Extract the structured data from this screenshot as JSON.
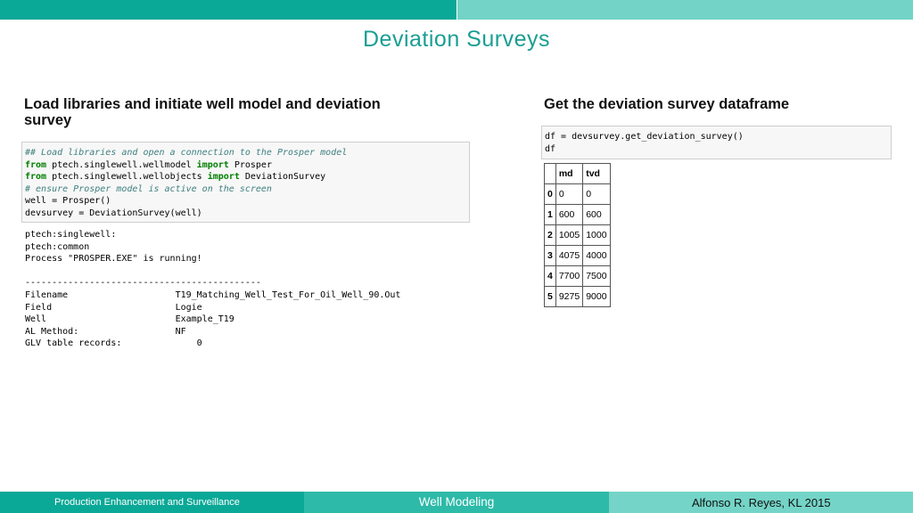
{
  "slide": {
    "title": "Deviation Surveys"
  },
  "left_section": {
    "heading_line1": "Load libraries and initiate well model and deviation",
    "heading_line2": "survey",
    "code": {
      "line1": "## Load libraries and open a connection to the Prosper model",
      "line2_kw1": "from",
      "line2_mid": " ptech.singlewell.wellmodel ",
      "line2_kw2": "import",
      "line2_end": " Prosper",
      "line3_kw1": "from",
      "line3_mid": " ptech.singlewell.wellobjects ",
      "line3_kw2": "import",
      "line3_end": " DeviationSurvey",
      "line4": "# ensure Prosper model is active on the screen",
      "line5": "well = Prosper()",
      "line6": "devsurvey = DeviationSurvey(well)"
    },
    "output": [
      "ptech:singlewell:",
      "ptech:common",
      "Process \"PROSPER.EXE\" is running!",
      "",
      "--------------------------------------------",
      "Filename                    T19_Matching_Well_Test_For_Oil_Well_90.Out",
      "Field                       Logie",
      "Well                        Example_T19",
      "AL Method:                  NF",
      "GLV table records:              0"
    ]
  },
  "right_section": {
    "heading": "Get the deviation survey dataframe",
    "code": {
      "line1": "df = devsurvey.get_deviation_survey()",
      "line2": "df"
    },
    "table": {
      "columns": [
        "",
        "md",
        "tvd"
      ],
      "rows": [
        [
          "0",
          "0",
          "0"
        ],
        [
          "1",
          "600",
          "600"
        ],
        [
          "2",
          "1005",
          "1000"
        ],
        [
          "3",
          "4075",
          "4000"
        ],
        [
          "4",
          "7700",
          "7500"
        ],
        [
          "5",
          "9275",
          "9000"
        ]
      ]
    }
  },
  "footer": {
    "left": "Production Enhancement and Surveillance",
    "center": "Well Modeling",
    "right": "Alfonso R. Reyes, KL 2015"
  }
}
